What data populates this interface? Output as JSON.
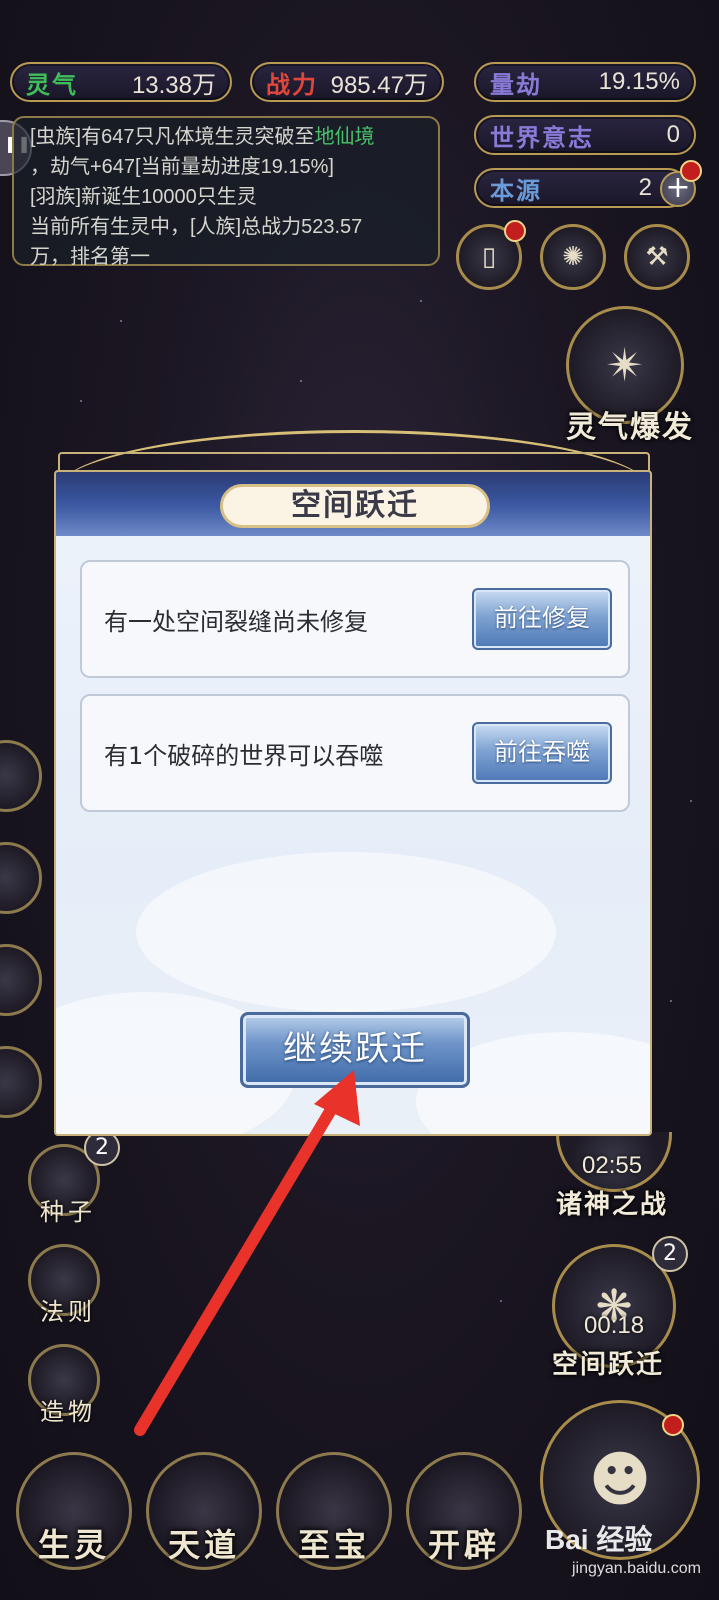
{
  "stats": {
    "lingqi": {
      "label": "灵气",
      "value": "13.38万",
      "color": "#3fbf5a"
    },
    "zhanli": {
      "label": "战力",
      "value": "985.47万",
      "color": "#e0463a"
    },
    "liangjie": {
      "label": "量劫",
      "value": "19.15%",
      "color": "#8a7ad8"
    },
    "world_will": {
      "label": "世界意志",
      "value": "0",
      "color": "#8a7ad8"
    },
    "benyuan": {
      "label": "本源",
      "value": "2",
      "color": "#6a9ad8"
    }
  },
  "news": {
    "line1a": "[虫族]有647只凡体境生灵突破至",
    "line1b": "地仙境",
    "line2": "，劫气+647[当前量劫进度19.15%]",
    "line3": "[羽族]新诞生10000只生灵",
    "line4": "当前所有生灵中，[人族]总战力523.57",
    "line5": "万，排名第一"
  },
  "right_icons": {
    "lingqi_burst": "灵气爆发",
    "gods_war": {
      "label": "诸神之战",
      "timer": "02:55"
    },
    "space_jump": {
      "label": "空间跃迁",
      "timer": "00:18",
      "badge": "2"
    }
  },
  "left_icons": {
    "seed": {
      "label": "种子",
      "badge": "2"
    },
    "law": "法则",
    "creation": "造物"
  },
  "bottom_nav": [
    "生灵",
    "天道",
    "至宝",
    "开辟"
  ],
  "dialog": {
    "title": "空间跃迁",
    "rows": [
      {
        "text": "有一处空间裂缝尚未修复",
        "button": "前往修复"
      },
      {
        "text": "有1个破碎的世界可以吞噬",
        "button": "前往吞噬"
      }
    ],
    "continue_button": "继续跃迁"
  },
  "watermark": {
    "brand": "Bai 经验",
    "url": "jingyan.baidu.com"
  }
}
